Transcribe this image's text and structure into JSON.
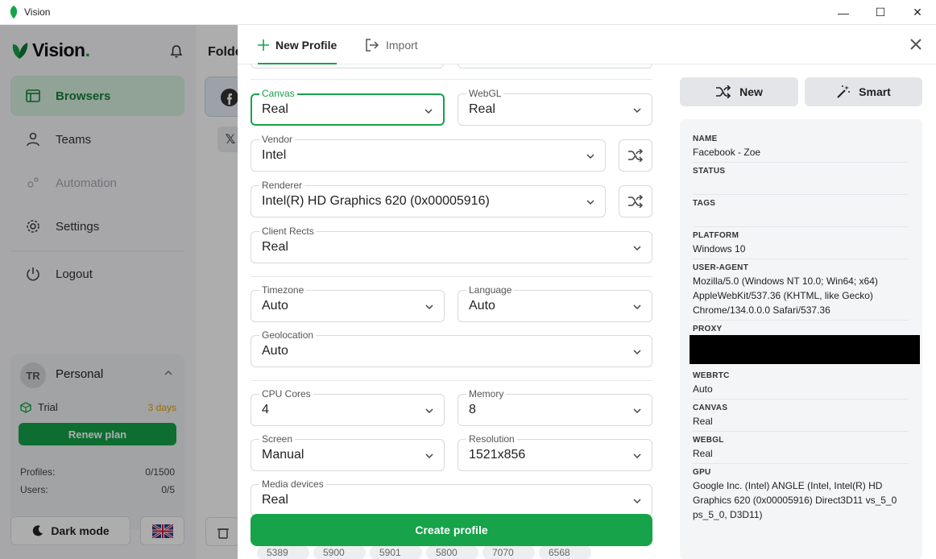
{
  "window": {
    "title": "Vision",
    "controls": {
      "minimize": "—",
      "maximize": "☐",
      "close": "✕"
    }
  },
  "sidebar": {
    "logo": "Vision",
    "logo_dot": ".",
    "nav": [
      {
        "label": "Browsers",
        "icon": "browser-window-icon",
        "active": true
      },
      {
        "label": "Teams",
        "icon": "user-icon"
      },
      {
        "label": "Automation",
        "icon": "gears-icon",
        "disabled": true
      },
      {
        "label": "Settings",
        "icon": "gear-icon"
      },
      {
        "label": "Logout",
        "icon": "power-icon"
      }
    ],
    "account": {
      "initials": "TR",
      "name": "Personal",
      "trial_label": "Trial",
      "trial_days": "3 days",
      "renew_label": "Renew plan",
      "profiles_label": "Profiles:",
      "profiles_value": "0/1500",
      "users_label": "Users:",
      "users_value": "0/5"
    },
    "dark_mode_label": "Dark mode"
  },
  "main": {
    "folder_title": "Folde"
  },
  "drawer": {
    "tabs": {
      "new_profile": "New Profile",
      "import": "Import"
    },
    "fields": {
      "canvas": {
        "label": "Canvas",
        "value": "Real"
      },
      "webgl": {
        "label": "WebGL",
        "value": "Real"
      },
      "vendor": {
        "label": "Vendor",
        "value": "Intel"
      },
      "renderer": {
        "label": "Renderer",
        "value": "Intel(R) HD Graphics 620 (0x00005916)"
      },
      "client_rects": {
        "label": "Client Rects",
        "value": "Real"
      },
      "timezone": {
        "label": "Timezone",
        "value": "Auto"
      },
      "language": {
        "label": "Language",
        "value": "Auto"
      },
      "geolocation": {
        "label": "Geolocation",
        "value": "Auto"
      },
      "cpu_cores": {
        "label": "CPU Cores",
        "value": "4"
      },
      "memory": {
        "label": "Memory",
        "value": "8"
      },
      "screen": {
        "label": "Screen",
        "value": "Manual"
      },
      "resolution": {
        "label": "Resolution",
        "value": "1521x856"
      },
      "media_devices": {
        "label": "Media devices",
        "value": "Real"
      }
    },
    "chips": [
      "5389",
      "5900",
      "5901",
      "5800",
      "7070",
      "6568"
    ],
    "create_label": "Create profile",
    "right_buttons": {
      "new": "New",
      "smart": "Smart"
    },
    "info": {
      "name_key": "NAME",
      "name_val": "Facebook - Zoe",
      "status_key": "STATUS",
      "tags_key": "TAGS",
      "platform_key": "PLATFORM",
      "platform_val": "Windows 10",
      "ua_key": "USER-AGENT",
      "ua_val": "Mozilla/5.0 (Windows NT 10.0; Win64; x64) AppleWebKit/537.36 (KHTML, like Gecko) Chrome/134.0.0.0 Safari/537.36",
      "proxy_key": "PROXY",
      "webrtc_key": "WEBRTC",
      "webrtc_val": "Auto",
      "canvas_key": "CANVAS",
      "canvas_val": "Real",
      "webgl_key": "WEBGL",
      "webgl_val": "Real",
      "gpu_key": "GPU",
      "gpu_val": "Google Inc. (Intel) ANGLE (Intel, Intel(R) HD Graphics 620 (0x00005916) Direct3D11 vs_5_0 ps_5_0, D3D11)"
    }
  },
  "colors": {
    "accent": "#16a34a",
    "trial_days": "#e0a300"
  }
}
